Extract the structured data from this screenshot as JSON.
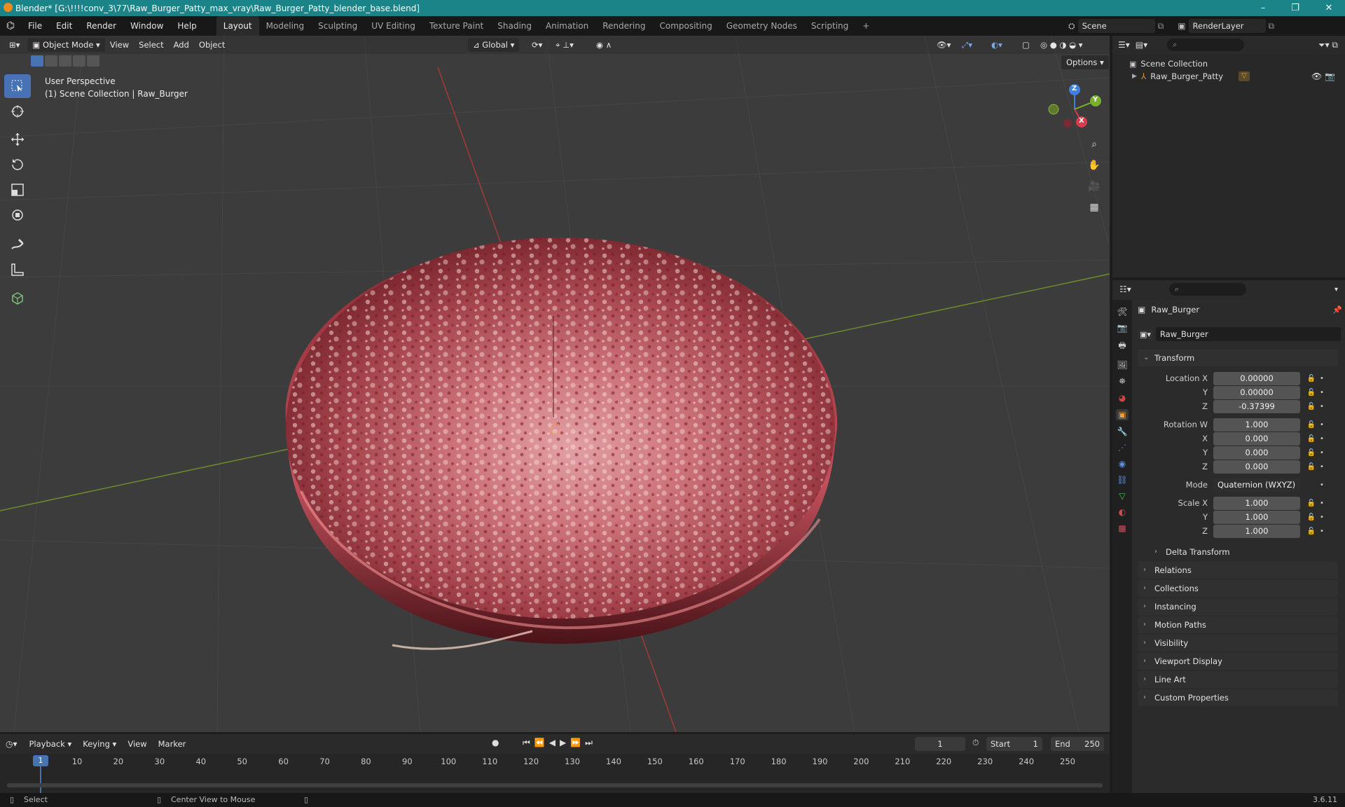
{
  "window": {
    "title": "Blender* [G:\\!!!!conv_3\\77\\Raw_Burger_Patty_max_vray\\Raw_Burger_Patty_blender_base.blend]",
    "controls": [
      "–",
      "❐",
      "✕"
    ]
  },
  "menu": [
    "File",
    "Edit",
    "Render",
    "Window",
    "Help"
  ],
  "workspaces": [
    "Layout",
    "Modeling",
    "Sculpting",
    "UV Editing",
    "Texture Paint",
    "Shading",
    "Animation",
    "Rendering",
    "Compositing",
    "Geometry Nodes",
    "Scripting",
    "+"
  ],
  "active_workspace": "Layout",
  "scene": {
    "name": "Scene",
    "render_layer": "RenderLayer"
  },
  "viewport": {
    "mode": "Object Mode",
    "menus": [
      "View",
      "Select",
      "Add",
      "Object"
    ],
    "transform_orientation": "Global",
    "options_label": "Options",
    "overlay_line1": "User Perspective",
    "overlay_line2": "(1) Scene Collection | Raw_Burger",
    "gizmo_axes": {
      "x": "X",
      "y": "Y",
      "z": "Z"
    }
  },
  "outliner": {
    "root": "Scene Collection",
    "items": [
      "Raw_Burger_Patty"
    ]
  },
  "properties": {
    "object_name": "Raw_Burger",
    "datablock_name": "Raw_Burger",
    "transform_header": "Transform",
    "location_label": "Location X",
    "location": {
      "x": "0.00000",
      "y": "0.00000",
      "z": "-0.37399"
    },
    "rotation_label": "Rotation W",
    "rotation": {
      "w": "1.000",
      "x": "0.000",
      "y": "0.000",
      "z": "0.000"
    },
    "mode_label": "Mode",
    "mode_value": "Quaternion (WXYZ)",
    "scale_label": "Scale X",
    "scale": {
      "x": "1.000",
      "y": "1.000",
      "z": "1.000"
    },
    "axis_labels": {
      "x": "X",
      "y": "Y",
      "z": "Z"
    },
    "delta_transform": "Delta Transform",
    "panels": [
      "Relations",
      "Collections",
      "Instancing",
      "Motion Paths",
      "Visibility",
      "Viewport Display",
      "Line Art",
      "Custom Properties"
    ]
  },
  "timeline": {
    "menus": [
      "Playback",
      "Keying",
      "View",
      "Marker"
    ],
    "current_frame": "1",
    "start_label": "Start",
    "start": "1",
    "end_label": "End",
    "end": "250",
    "ticks": [
      "10",
      "20",
      "30",
      "40",
      "50",
      "60",
      "70",
      "80",
      "90",
      "100",
      "110",
      "120",
      "130",
      "140",
      "150",
      "160",
      "170",
      "180",
      "190",
      "200",
      "210",
      "220",
      "230",
      "240",
      "250"
    ],
    "playhead_label": "1"
  },
  "status": {
    "select": "Select",
    "center_view": "Center View to Mouse",
    "version": "3.6.11"
  }
}
